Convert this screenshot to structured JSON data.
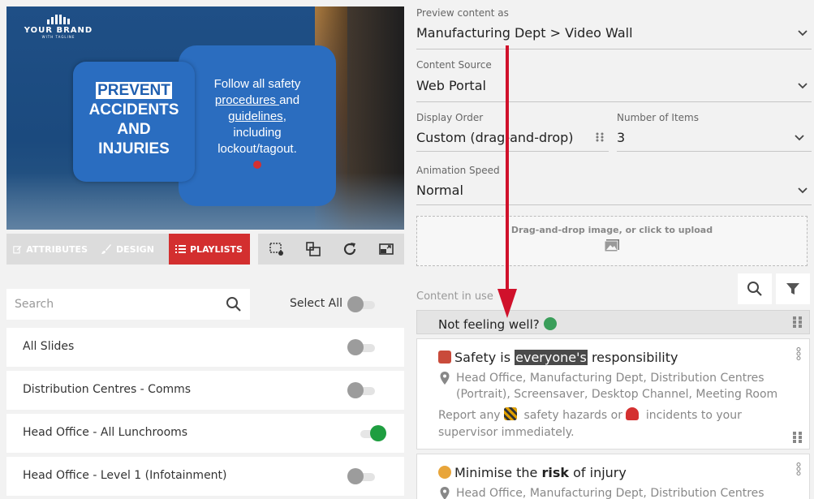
{
  "preview": {
    "brand_name": "YOUR BRAND",
    "brand_tagline": "WITH TAGLINE",
    "left_card": {
      "highlight": "PREVENT",
      "line2": "ACCIDENTS",
      "line3": "AND",
      "line4": "INJURIES"
    },
    "right_card": {
      "l1": "Follow all safety",
      "l2a": "procedures ",
      "l2b": "and",
      "l3a": "guidelines",
      "l3b": ",",
      "l4": "including",
      "l5": "lockout/tagout."
    }
  },
  "tabs": [
    {
      "label": "ATTRIBUTES",
      "icon": "edit-icon",
      "active": false
    },
    {
      "label": "DESIGN",
      "icon": "brush-icon",
      "active": false
    },
    {
      "label": "PLAYLISTS",
      "icon": "list-icon",
      "active": true
    }
  ],
  "toolbar": {
    "icons": [
      "crop-settings-icon",
      "layout-icon",
      "refresh-icon",
      "fullscreen-icon"
    ]
  },
  "search": {
    "placeholder": "Search",
    "value": ""
  },
  "select_all": {
    "label": "Select All",
    "on": false
  },
  "playlists": [
    {
      "label": "All Slides",
      "on": false
    },
    {
      "label": "Distribution Centres - Comms",
      "on": false
    },
    {
      "label": "Head Office - All Lunchrooms",
      "on": true
    },
    {
      "label": "Head Office - Level 1 (Infotainment)",
      "on": false
    }
  ],
  "form": {
    "preview_as": {
      "label": "Preview content as",
      "value": "Manufacturing Dept > Video Wall"
    },
    "content_source": {
      "label": "Content Source",
      "value": "Web Portal"
    },
    "display_order": {
      "label": "Display Order",
      "value": "Custom (drag-and-drop)"
    },
    "num_items": {
      "label": "Number of Items",
      "value": "3"
    },
    "animation_speed": {
      "label": "Animation Speed",
      "value": "Normal"
    }
  },
  "dropzone": {
    "text": "Drag-and-drop image, or click to upload"
  },
  "content_in_use": {
    "label": "Content in use",
    "selected_item": "Not feeling well?",
    "items": [
      {
        "title_pre": "Safety is ",
        "title_hl": "everyone's",
        "title_post": " responsibility",
        "locations": "Head Office, Manufacturing Dept, Distribution Centres (Portrait), Screensaver, Desktop Channel, Meeting Room",
        "desc_a": "Report any ",
        "desc_b": " safety hazards or ",
        "desc_c": " incidents to your supervisor immediately."
      },
      {
        "title_pre": "Minimise the ",
        "title_bold": "risk",
        "title_post": " of injury",
        "locations": "Head Office, Manufacturing Dept, Distribution Centres"
      }
    ]
  },
  "colors": {
    "accent_red": "#d32f2f",
    "toggle_on": "#1e9e40",
    "card_blue": "#2b6dbf"
  }
}
